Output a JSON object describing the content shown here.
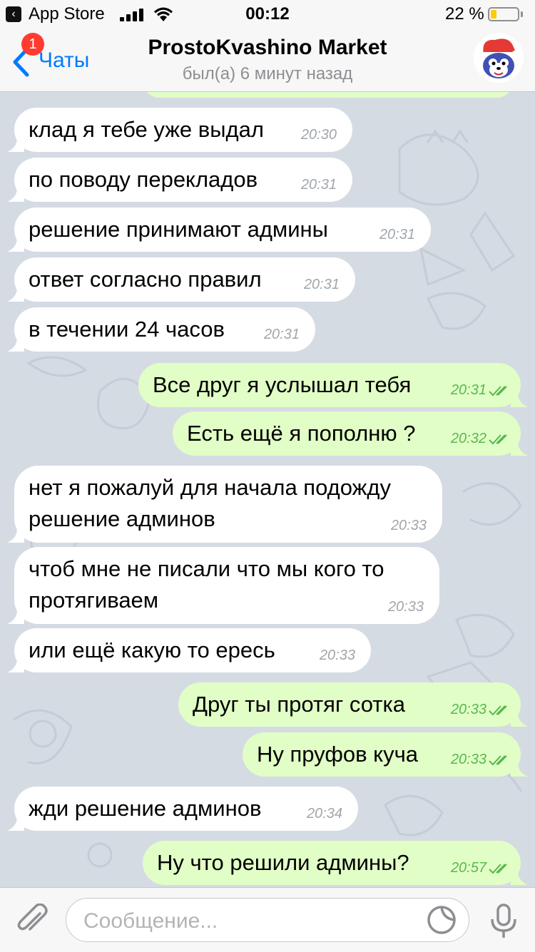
{
  "status_bar": {
    "back_app": "App Store",
    "time": "00:12",
    "battery_percent": "22 %",
    "battery_level": 0.22,
    "signal_bars": 4,
    "back_glyph": "‹"
  },
  "header": {
    "back_label": "Чаты",
    "unread_badge": "1",
    "title": "ProstoKvashino Market",
    "subtitle": "был(а) 6 минут назад"
  },
  "messages": [
    {
      "dir": "in",
      "lines": [
        "клад я тебе уже выдал"
      ],
      "time": "20:30"
    },
    {
      "dir": "in",
      "lines": [
        "по поводу перекладов"
      ],
      "time": "20:31"
    },
    {
      "dir": "in",
      "lines": [
        "решение принимают админы"
      ],
      "time": "20:31"
    },
    {
      "dir": "in",
      "lines": [
        "ответ согласно правил"
      ],
      "time": "20:31"
    },
    {
      "dir": "in",
      "lines": [
        "в течении 24 часов"
      ],
      "time": "20:31"
    },
    {
      "dir": "out",
      "lines": [
        "Все друг я услышал тебя"
      ],
      "time": "20:31",
      "read": true
    },
    {
      "dir": "out",
      "lines": [
        "Есть ещё я пополню ?"
      ],
      "time": "20:32",
      "read": true
    },
    {
      "dir": "in",
      "lines": [
        "нет я пожалуй для начала подожду",
        "решение админов"
      ],
      "time": "20:33"
    },
    {
      "dir": "in",
      "lines": [
        "чтоб мне не писали что мы кого то",
        "протягиваем"
      ],
      "time": "20:33"
    },
    {
      "dir": "in",
      "lines": [
        "или ещё какую то ересь"
      ],
      "time": "20:33"
    },
    {
      "dir": "out",
      "lines": [
        "Друг ты протяг сотка"
      ],
      "time": "20:33",
      "read": true
    },
    {
      "dir": "out",
      "lines": [
        "Ну пруфов куча"
      ],
      "time": "20:33",
      "read": true
    },
    {
      "dir": "in",
      "lines": [
        "жди решение админов"
      ],
      "time": "20:34"
    },
    {
      "dir": "out",
      "lines": [
        "Ну что решили админы?"
      ],
      "time": "20:57",
      "read": true
    }
  ],
  "composer": {
    "placeholder": "Сообщение..."
  },
  "icons": {
    "back": "chevron-left-icon",
    "attach": "paperclip-icon",
    "sticker": "sticker-icon",
    "mic": "microphone-icon",
    "read": "double-check-icon"
  },
  "colors": {
    "accent": "#007aff",
    "badge": "#ff3b30",
    "incoming_bubble": "#ffffff",
    "outgoing_bubble": "#e1fec6",
    "outgoing_time": "#59b84f",
    "chat_background": "#d5dbe3",
    "battery": "#ffcc00"
  }
}
